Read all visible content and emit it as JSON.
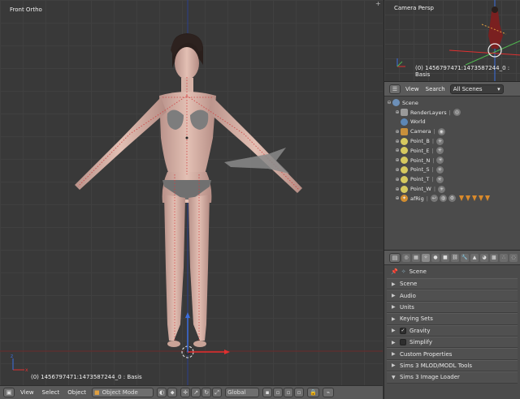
{
  "viewport": {
    "label": "Front Ortho",
    "status": "(0) 1456797471:1473587244_0 : Basis"
  },
  "header3d": {
    "menus": [
      "View",
      "Select",
      "Object"
    ],
    "mode": "Object Mode",
    "orientation": "Global"
  },
  "camview": {
    "label": "Camera Persp",
    "status": "(0) 1456797471:1473587244_0 : Basis"
  },
  "outliner": {
    "menus": [
      "View",
      "Search"
    ],
    "scene_filter": "All Scenes",
    "rows": [
      {
        "name": "Scene",
        "icon": "scene-icon",
        "indent": 0
      },
      {
        "name": "RenderLayers",
        "icon": "render-layers-icon",
        "indent": 1
      },
      {
        "name": "World",
        "icon": "world-icon",
        "indent": 1
      },
      {
        "name": "Camera",
        "icon": "camera-icon",
        "indent": 1
      },
      {
        "name": "Point_B",
        "icon": "lamp-icon",
        "indent": 1
      },
      {
        "name": "Point_E",
        "icon": "lamp-icon",
        "indent": 1
      },
      {
        "name": "Point_N",
        "icon": "lamp-icon",
        "indent": 1
      },
      {
        "name": "Point_S",
        "icon": "lamp-icon",
        "indent": 1
      },
      {
        "name": "Point_T",
        "icon": "lamp-icon",
        "indent": 1
      },
      {
        "name": "Point_W",
        "icon": "lamp-icon",
        "indent": 1
      },
      {
        "name": "afRig",
        "icon": "armature-icon",
        "indent": 1
      }
    ]
  },
  "props": {
    "context": "Scene",
    "panels": [
      {
        "label": "Scene",
        "check": false
      },
      {
        "label": "Audio",
        "check": false
      },
      {
        "label": "Units",
        "check": false
      },
      {
        "label": "Keying Sets",
        "check": false
      },
      {
        "label": "Gravity",
        "check": true,
        "checked": true
      },
      {
        "label": "Simplify",
        "check": true,
        "checked": false
      },
      {
        "label": "Custom Properties",
        "check": false
      },
      {
        "label": "Sims 3 MLOD/MODL Tools",
        "check": false
      },
      {
        "label": "Sims 3 Image Loader",
        "check": false,
        "expanded": true
      }
    ]
  },
  "colors": {
    "viewport_bg": "#393939",
    "panel_bg": "#4b4b4b",
    "header_bg": "#5a5a5a",
    "axis_x": "#e03030",
    "axis_y": "#3b6ee0",
    "axis_z": "#4fb84f"
  }
}
